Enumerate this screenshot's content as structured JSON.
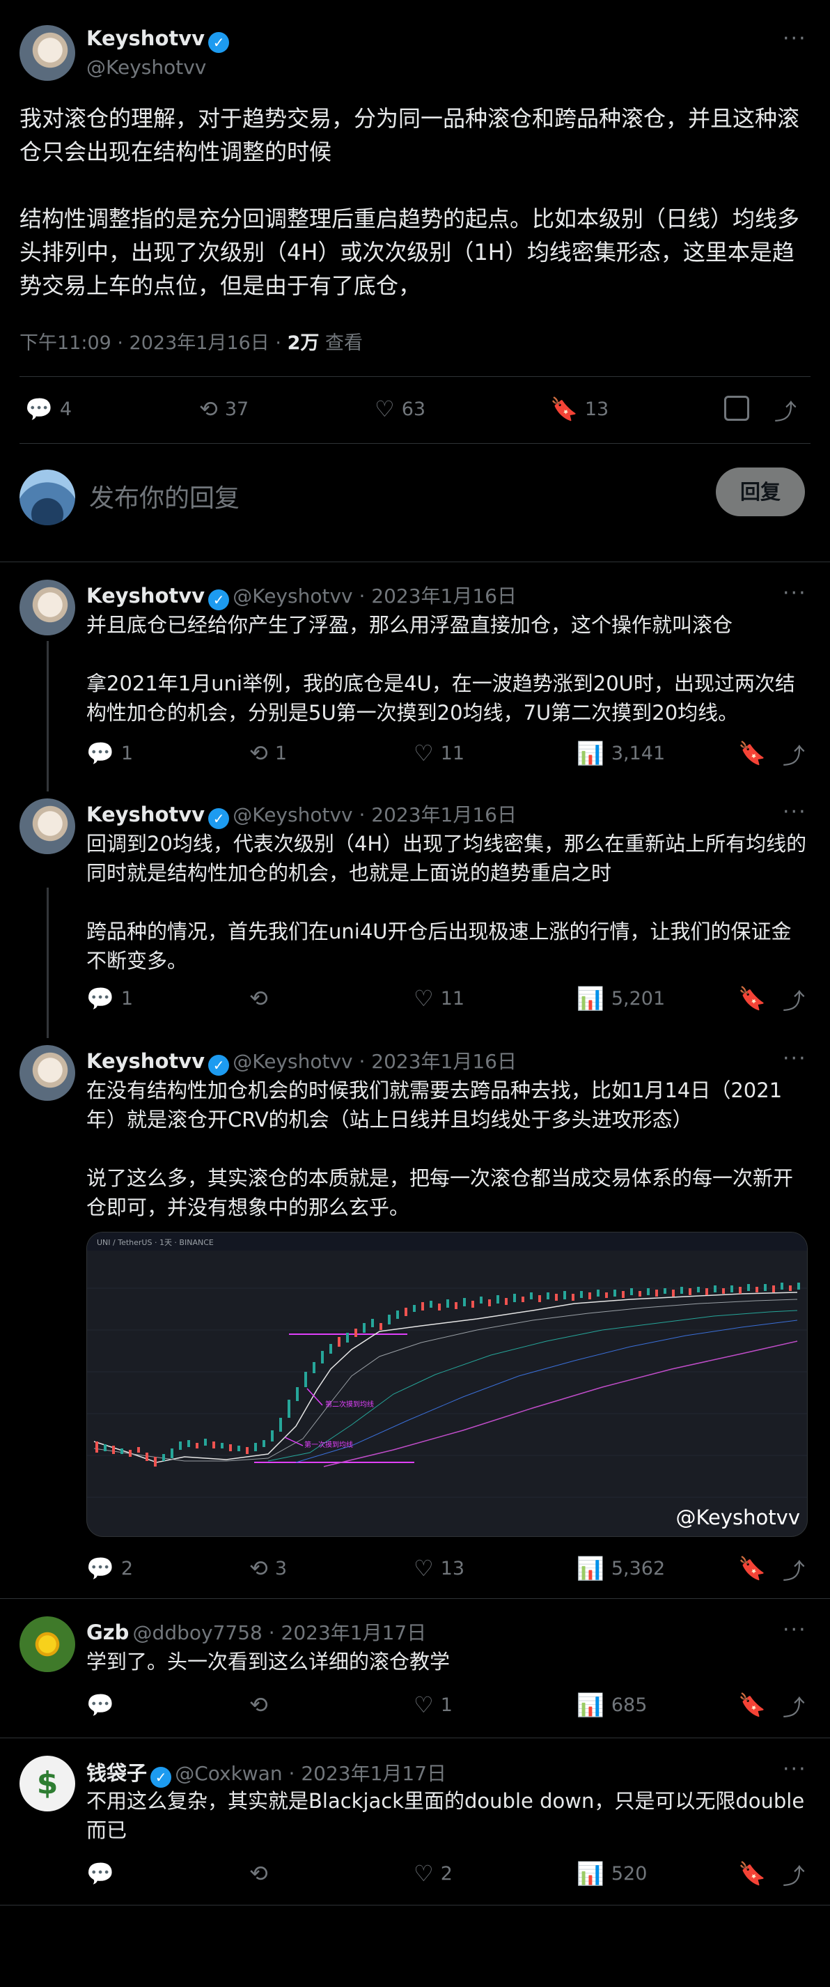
{
  "main_tweet": {
    "author_name": "Keyshotvv",
    "author_handle": "@Keyshotvv",
    "text": "我对滚仓的理解，对于趋势交易，分为同一品种滚仓和跨品种滚仓，并且这种滚仓只会出现在结构性调整的时候\n\n结构性调整指的是充分回调整理后重启趋势的起点。比如本级别（日线）均线多头排列中，出现了次级别（4H）或次次级别（1H）均线密集形态，这里本是趋势交易上车的点位，但是由于有了底仓，",
    "time": "下午11:09 · 2023年1月16日 · ",
    "views_count": "2万",
    "views_label": " 查看",
    "replies": "4",
    "retweets": "37",
    "likes": "63",
    "bookmarks": "13"
  },
  "compose": {
    "placeholder": "发布你的回复",
    "button": "回复"
  },
  "thread": [
    {
      "name": "Keyshotvv",
      "handle": "@Keyshotvv · 2023年1月16日",
      "text": "并且底仓已经给你产生了浮盈，那么用浮盈直接加仓，这个操作就叫滚仓\n\n拿2021年1月uni举例，我的底仓是4U，在一波趋势涨到20U时，出现过两次结构性加仓的机会，分别是5U第一次摸到20均线，7U第二次摸到20均线。",
      "replies": "1",
      "retweets": "1",
      "likes": "11",
      "views": "3,141"
    },
    {
      "name": "Keyshotvv",
      "handle": "@Keyshotvv · 2023年1月16日",
      "text": "回调到20均线，代表次级别（4H）出现了均线密集，那么在重新站上所有均线的同时就是结构性加仓的机会，也就是上面说的趋势重启之时\n\n跨品种的情况，首先我们在uni4U开仓后出现极速上涨的行情，让我们的保证金不断变多。",
      "replies": "1",
      "retweets": "",
      "likes": "11",
      "views": "5,201"
    },
    {
      "name": "Keyshotvv",
      "handle": "@Keyshotvv · 2023年1月16日",
      "text": "在没有结构性加仓机会的时候我们就需要去跨品种去找，比如1月14日（2021年）就是滚仓开CRV的机会（站上日线并且均线处于多头进攻形态）\n\n说了这么多，其实滚仓的本质就是，把每一次滚仓都当成交易体系的每一次新开仓即可，并没有想象中的那么玄乎。",
      "replies": "2",
      "retweets": "3",
      "likes": "13",
      "views": "5,362",
      "image_watermark": "@Keyshotvv"
    }
  ],
  "replies": [
    {
      "name": "Gzb",
      "handle": "@ddboy7758 · 2023年1月17日",
      "text": "学到了。头一次看到这么详细的滚仓教学",
      "replies": "",
      "retweets": "",
      "likes": "1",
      "views": "685"
    },
    {
      "name": "钱袋子",
      "handle": "@Coxkwan · 2023年1月17日",
      "text": "不用这么复杂，其实就是Blackjack里面的double down，只是可以无限double而已",
      "replies": "",
      "retweets": "",
      "likes": "2",
      "views": "520"
    }
  ],
  "icons": {
    "reply": "💬",
    "retweet": "⟲",
    "like": "♡",
    "views": "📊",
    "bookmark": "🔖",
    "share": "⤴",
    "more": "···",
    "verified": "✓"
  },
  "chart_labels": {
    "symbol": "UNI / TetherUS · 1天 · BINANCE",
    "note_1": "第二次摸到均线",
    "note_2": "第一次摸到均线"
  },
  "colors": {
    "accent_blue": "#1d9bf0",
    "muted": "#71767b",
    "background": "#000000",
    "divider": "#2f3336"
  }
}
